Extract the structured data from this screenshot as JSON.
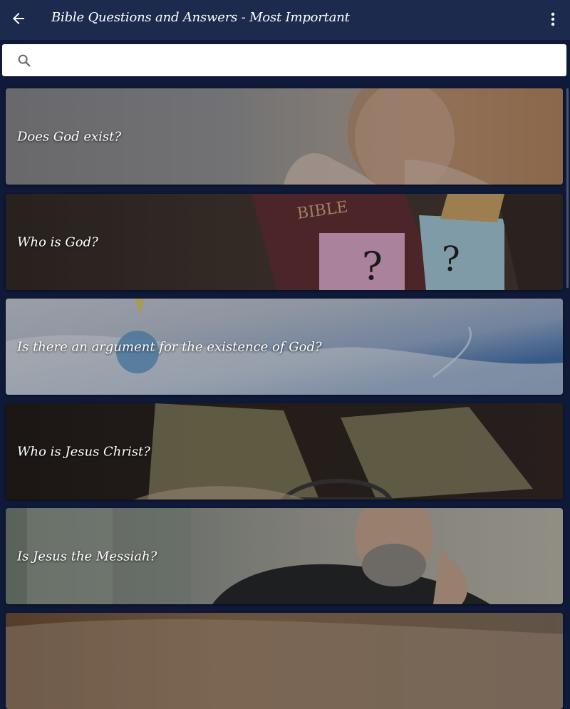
{
  "header": {
    "title": "Bible Questions and Answers - Most Important",
    "back_icon": "arrow-left-icon",
    "menu_icon": "more-vert-icon"
  },
  "search": {
    "icon": "search-icon",
    "value": "",
    "placeholder": ""
  },
  "questions": [
    {
      "label": "Does God exist?"
    },
    {
      "label": "Who is God?"
    },
    {
      "label": "Is there an argument for the existence of God?"
    },
    {
      "label": "Who is Jesus Christ?"
    },
    {
      "label": "Is Jesus the Messiah?"
    },
    {
      "label": ""
    }
  ],
  "colors": {
    "app_bar": "#1b2a4d",
    "background": "#0f1a38",
    "text": "#ffffff"
  }
}
